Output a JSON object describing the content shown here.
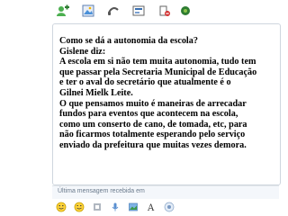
{
  "toolbar": {
    "icons": [
      "contacts-icon",
      "photo-icon",
      "call-icon",
      "activities-icon",
      "block-icon",
      "games-icon"
    ]
  },
  "message": {
    "lines": [
      "Como se dá a autonomia da escola?",
      "Gislene diz:",
      "A escola em si não tem muita autonomia, tudo tem",
      "que passar pela Secretaria Municipal de Educação",
      "e ter o aval do secretário que atualmente é o",
      "Gilnei Mielk Leite.",
      "O que pensamos muito é maneiras de arrecadar",
      "fundos para eventos que acontecem na escola,",
      "como um conserto de cano, de tomada, etc, para",
      "não ficarmos totalmente esperando pelo serviço",
      "enviado da prefeitura que muitas vezes demora."
    ]
  },
  "status": {
    "text": "Última mensagem recebida em"
  },
  "bottombar": {
    "icons": [
      "emoticon-icon",
      "wink-icon",
      "nudge-icon",
      "voice-clip-icon",
      "background-icon",
      "font-icon",
      "bold-icon"
    ]
  }
}
